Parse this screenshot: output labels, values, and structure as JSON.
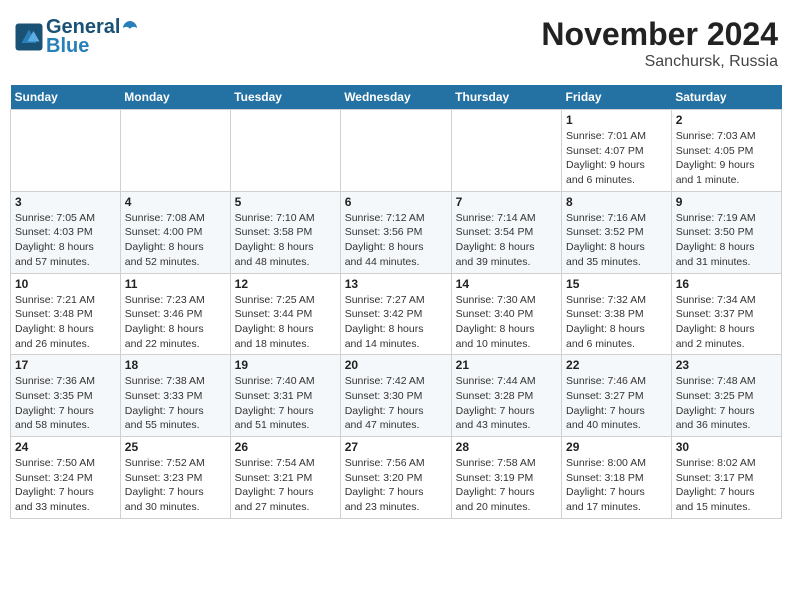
{
  "header": {
    "logo_line1": "General",
    "logo_line2": "Blue",
    "month": "November 2024",
    "location": "Sanchursk, Russia"
  },
  "weekdays": [
    "Sunday",
    "Monday",
    "Tuesday",
    "Wednesday",
    "Thursday",
    "Friday",
    "Saturday"
  ],
  "weeks": [
    [
      {
        "day": "",
        "info": ""
      },
      {
        "day": "",
        "info": ""
      },
      {
        "day": "",
        "info": ""
      },
      {
        "day": "",
        "info": ""
      },
      {
        "day": "",
        "info": ""
      },
      {
        "day": "1",
        "info": "Sunrise: 7:01 AM\nSunset: 4:07 PM\nDaylight: 9 hours\nand 6 minutes."
      },
      {
        "day": "2",
        "info": "Sunrise: 7:03 AM\nSunset: 4:05 PM\nDaylight: 9 hours\nand 1 minute."
      }
    ],
    [
      {
        "day": "3",
        "info": "Sunrise: 7:05 AM\nSunset: 4:03 PM\nDaylight: 8 hours\nand 57 minutes."
      },
      {
        "day": "4",
        "info": "Sunrise: 7:08 AM\nSunset: 4:00 PM\nDaylight: 8 hours\nand 52 minutes."
      },
      {
        "day": "5",
        "info": "Sunrise: 7:10 AM\nSunset: 3:58 PM\nDaylight: 8 hours\nand 48 minutes."
      },
      {
        "day": "6",
        "info": "Sunrise: 7:12 AM\nSunset: 3:56 PM\nDaylight: 8 hours\nand 44 minutes."
      },
      {
        "day": "7",
        "info": "Sunrise: 7:14 AM\nSunset: 3:54 PM\nDaylight: 8 hours\nand 39 minutes."
      },
      {
        "day": "8",
        "info": "Sunrise: 7:16 AM\nSunset: 3:52 PM\nDaylight: 8 hours\nand 35 minutes."
      },
      {
        "day": "9",
        "info": "Sunrise: 7:19 AM\nSunset: 3:50 PM\nDaylight: 8 hours\nand 31 minutes."
      }
    ],
    [
      {
        "day": "10",
        "info": "Sunrise: 7:21 AM\nSunset: 3:48 PM\nDaylight: 8 hours\nand 26 minutes."
      },
      {
        "day": "11",
        "info": "Sunrise: 7:23 AM\nSunset: 3:46 PM\nDaylight: 8 hours\nand 22 minutes."
      },
      {
        "day": "12",
        "info": "Sunrise: 7:25 AM\nSunset: 3:44 PM\nDaylight: 8 hours\nand 18 minutes."
      },
      {
        "day": "13",
        "info": "Sunrise: 7:27 AM\nSunset: 3:42 PM\nDaylight: 8 hours\nand 14 minutes."
      },
      {
        "day": "14",
        "info": "Sunrise: 7:30 AM\nSunset: 3:40 PM\nDaylight: 8 hours\nand 10 minutes."
      },
      {
        "day": "15",
        "info": "Sunrise: 7:32 AM\nSunset: 3:38 PM\nDaylight: 8 hours\nand 6 minutes."
      },
      {
        "day": "16",
        "info": "Sunrise: 7:34 AM\nSunset: 3:37 PM\nDaylight: 8 hours\nand 2 minutes."
      }
    ],
    [
      {
        "day": "17",
        "info": "Sunrise: 7:36 AM\nSunset: 3:35 PM\nDaylight: 7 hours\nand 58 minutes."
      },
      {
        "day": "18",
        "info": "Sunrise: 7:38 AM\nSunset: 3:33 PM\nDaylight: 7 hours\nand 55 minutes."
      },
      {
        "day": "19",
        "info": "Sunrise: 7:40 AM\nSunset: 3:31 PM\nDaylight: 7 hours\nand 51 minutes."
      },
      {
        "day": "20",
        "info": "Sunrise: 7:42 AM\nSunset: 3:30 PM\nDaylight: 7 hours\nand 47 minutes."
      },
      {
        "day": "21",
        "info": "Sunrise: 7:44 AM\nSunset: 3:28 PM\nDaylight: 7 hours\nand 43 minutes."
      },
      {
        "day": "22",
        "info": "Sunrise: 7:46 AM\nSunset: 3:27 PM\nDaylight: 7 hours\nand 40 minutes."
      },
      {
        "day": "23",
        "info": "Sunrise: 7:48 AM\nSunset: 3:25 PM\nDaylight: 7 hours\nand 36 minutes."
      }
    ],
    [
      {
        "day": "24",
        "info": "Sunrise: 7:50 AM\nSunset: 3:24 PM\nDaylight: 7 hours\nand 33 minutes."
      },
      {
        "day": "25",
        "info": "Sunrise: 7:52 AM\nSunset: 3:23 PM\nDaylight: 7 hours\nand 30 minutes."
      },
      {
        "day": "26",
        "info": "Sunrise: 7:54 AM\nSunset: 3:21 PM\nDaylight: 7 hours\nand 27 minutes."
      },
      {
        "day": "27",
        "info": "Sunrise: 7:56 AM\nSunset: 3:20 PM\nDaylight: 7 hours\nand 23 minutes."
      },
      {
        "day": "28",
        "info": "Sunrise: 7:58 AM\nSunset: 3:19 PM\nDaylight: 7 hours\nand 20 minutes."
      },
      {
        "day": "29",
        "info": "Sunrise: 8:00 AM\nSunset: 3:18 PM\nDaylight: 7 hours\nand 17 minutes."
      },
      {
        "day": "30",
        "info": "Sunrise: 8:02 AM\nSunset: 3:17 PM\nDaylight: 7 hours\nand 15 minutes."
      }
    ]
  ]
}
